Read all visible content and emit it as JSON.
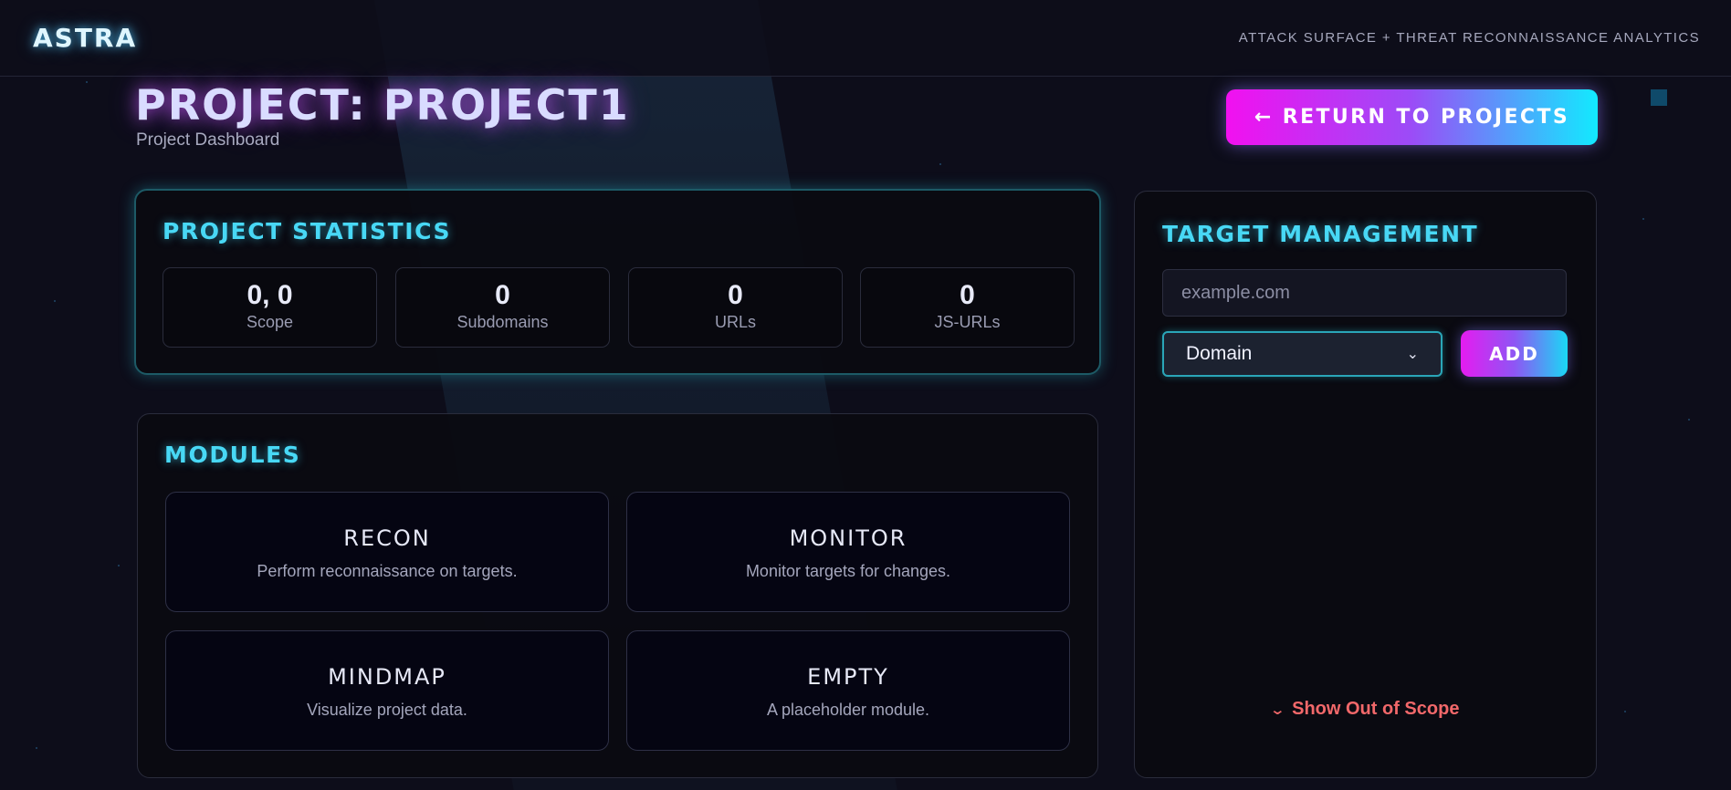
{
  "app": {
    "logo": "ASTRA",
    "tagline": "ATTACK SURFACE + THREAT RECONNAISSANCE ANALYTICS"
  },
  "header": {
    "title": "PROJECT: PROJECT1",
    "subtitle": "Project Dashboard",
    "return_button": "← RETURN TO PROJECTS"
  },
  "stats": {
    "heading": "PROJECT STATISTICS",
    "items": [
      {
        "value": "0, 0",
        "label": "Scope"
      },
      {
        "value": "0",
        "label": "Subdomains"
      },
      {
        "value": "0",
        "label": "URLs"
      },
      {
        "value": "0",
        "label": "JS-URLs"
      }
    ]
  },
  "modules": {
    "heading": "MODULES",
    "items": [
      {
        "name": "RECON",
        "description": "Perform reconnaissance on targets."
      },
      {
        "name": "MONITOR",
        "description": "Monitor targets for changes."
      },
      {
        "name": "MINDMAP",
        "description": "Visualize project data."
      },
      {
        "name": "EMPTY",
        "description": "A placeholder module."
      }
    ]
  },
  "target": {
    "heading": "TARGET MANAGEMENT",
    "input_placeholder": "example.com",
    "type_selected": "Domain",
    "add_button": "ADD",
    "toggle_label": "Show Out of Scope"
  },
  "colors": {
    "accent_cyan": "#48d8f5",
    "accent_magenta": "#f210f0",
    "warning": "#f2686a"
  }
}
